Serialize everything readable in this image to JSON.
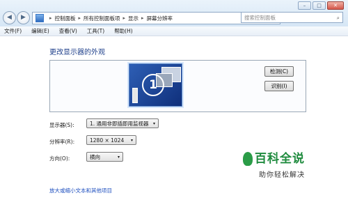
{
  "window": {
    "minimize": "–",
    "maximize": "□",
    "close": "✕"
  },
  "nav": {
    "back_icon": "arrow-left-icon",
    "forward_icon": "arrow-right-icon"
  },
  "address": {
    "crumbs": [
      "控制面板",
      "所有控制面板项",
      "显示",
      "屏幕分辨率"
    ],
    "sep": "▸",
    "dropdown": "▾",
    "refresh": "↻"
  },
  "search": {
    "placeholder": "搜索控制面板",
    "icon": "⌕"
  },
  "menu": [
    "文件(F)",
    "编辑(E)",
    "查看(V)",
    "工具(T)",
    "帮助(H)"
  ],
  "page": {
    "title": "更改显示器的外观"
  },
  "preview": {
    "monitor_number": "1",
    "detect_button": "检测(C)",
    "identify_button": "识别(I)"
  },
  "settings": {
    "display": {
      "label": "显示器(S):",
      "value": "1. 通用非即插即用监视器"
    },
    "resolution": {
      "label": "分辨率(R):",
      "value": "1280 × 1024"
    },
    "orientation": {
      "label": "方向(O):",
      "value": "横向"
    },
    "arrow": "▾"
  },
  "link": "放大或缩小文本和其他项目",
  "watermark": {
    "title": "百科全说",
    "subtitle": "助你轻松解决"
  }
}
